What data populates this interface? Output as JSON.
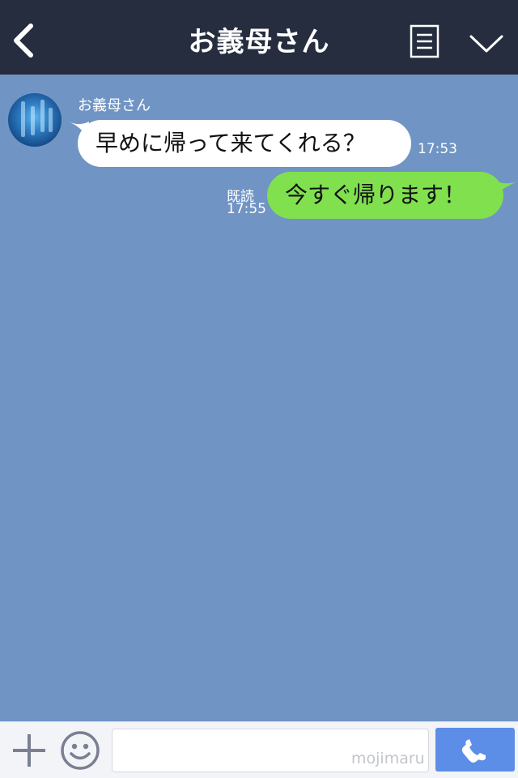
{
  "header": {
    "title": "お義母さん",
    "back_icon": "chevron-left-icon",
    "menu_icon": "list-icon",
    "collapse_icon": "chevron-down-icon"
  },
  "messages": [
    {
      "direction": "incoming",
      "sender": "お義母さん",
      "text": "早めに帰って来てくれる？",
      "time": "17:53"
    },
    {
      "direction": "outgoing",
      "read": "既読",
      "text": "今すぐ帰ります！",
      "time": "17:55"
    }
  ],
  "composer": {
    "watermark": "mojimaru",
    "plus_icon": "plus-icon",
    "emoji_icon": "smiley-icon",
    "call_icon": "phone-icon"
  },
  "colors": {
    "header_bg": "#252d3f",
    "chat_bg": "#7094c4",
    "incoming_bubble": "#ffffff",
    "outgoing_bubble": "#80e04e",
    "call_button": "#5c8ee8"
  }
}
